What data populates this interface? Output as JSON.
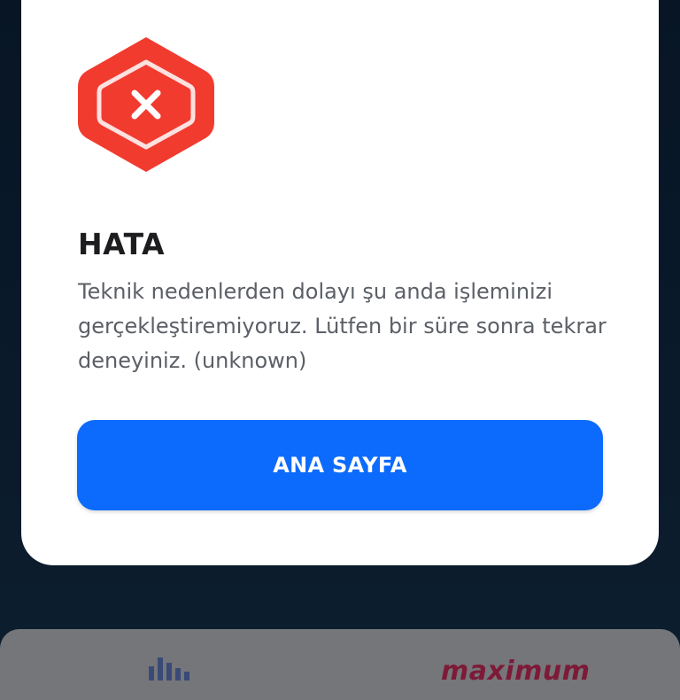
{
  "dialog": {
    "icon": "error-hexagon-x-icon",
    "title": "HATA",
    "message": "Teknik nedenlerden dolayı şu anda işleminizi gerçekleştiremiyoruz. Lütfen bir süre sonra tekrar deneyiniz. (unknown)",
    "button_label": "ANA SAYFA"
  },
  "bottom_card": {
    "left_icon": "bar-chart-icon",
    "brand_logo": "maximum"
  },
  "colors": {
    "error_red": "#f23b2f",
    "primary_blue": "#0c6bfd",
    "brand_maroon": "#7d1a38",
    "backdrop": "#071524"
  }
}
